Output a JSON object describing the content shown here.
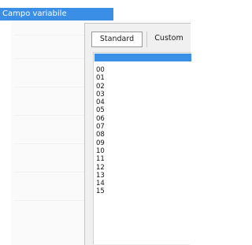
{
  "field": {
    "label": "Campo variabile"
  },
  "tabs": [
    {
      "label": "Standard",
      "selected": true
    },
    {
      "label": "Custom",
      "selected": false
    }
  ],
  "list": {
    "items": [
      "00",
      "01",
      "02",
      "03",
      "04",
      "05",
      "06",
      "07",
      "08",
      "09",
      "10",
      "11",
      "12",
      "13",
      "14",
      "15"
    ]
  },
  "colors": {
    "accent": "#3a8ee6",
    "dialog_bg": "#f0f0f0",
    "list_bg": "#ffffff"
  }
}
